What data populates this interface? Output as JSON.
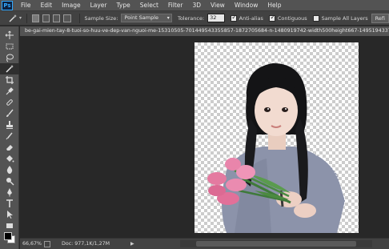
{
  "app": {
    "logo": "Ps"
  },
  "menu": [
    "File",
    "Edit",
    "Image",
    "Layer",
    "Type",
    "Select",
    "Filter",
    "3D",
    "View",
    "Window",
    "Help"
  ],
  "options": {
    "tool_icon": "magic-wand-icon",
    "sample_size_label": "Sample Size:",
    "sample_size_value": "Point Sample",
    "tolerance_label": "Tolerance:",
    "tolerance_value": "32",
    "antialias_label": "Anti-alias",
    "antialias_checked": true,
    "contiguous_label": "Contiguous",
    "contiguous_checked": true,
    "sample_all_layers_label": "Sample All Layers",
    "sample_all_layers_checked": false,
    "refine_label": "Refi"
  },
  "document": {
    "tab_title": "be-gai-mien-tay-8-tuoi-so-huu-ve-dep-van-nguoi-me-15310505-701449543355857-1872705684-n-1480919742-width500height667-1495194337?"
  },
  "toolbar": {
    "tools": [
      "move-icon",
      "marquee-icon",
      "lasso-icon",
      "magic-wand-icon",
      "crop-icon",
      "eyedropper-icon",
      "healing-brush-icon",
      "brush-icon",
      "clone-stamp-icon",
      "history-brush-icon",
      "eraser-icon",
      "paint-bucket-icon",
      "blur-icon",
      "dodge-icon",
      "pen-icon",
      "type-icon",
      "path-selection-icon",
      "rectangle-icon"
    ],
    "active_tool": 3
  },
  "status": {
    "zoom": "66,67%",
    "doc_info": "Doc: 977,1K/1,27M"
  },
  "colors": {
    "foreground": "#000000",
    "background": "#ffffff"
  }
}
